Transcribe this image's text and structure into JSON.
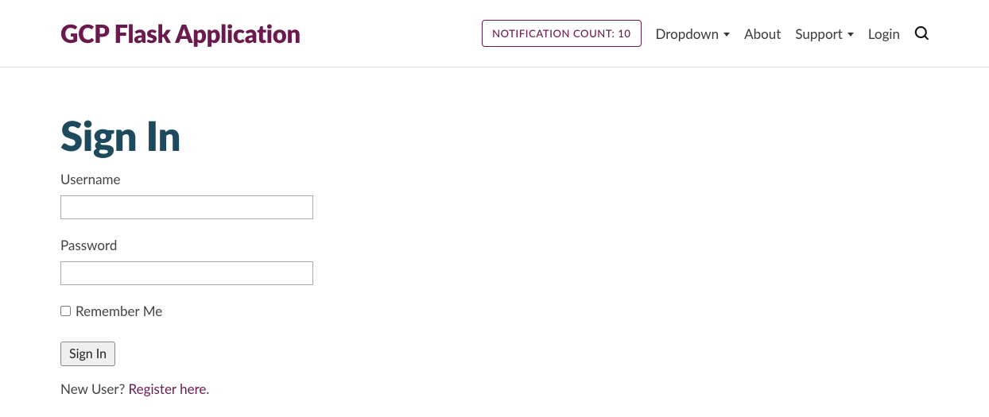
{
  "navbar": {
    "brand": "GCP Flask Application",
    "notification_label": "NOTIFICATION COUNT: 10",
    "dropdown_label": "Dropdown",
    "about_label": "About",
    "support_label": "Support",
    "login_label": "Login"
  },
  "main": {
    "heading": "Sign In",
    "username_label": "Username",
    "password_label": "Password",
    "remember_label": "Remember Me",
    "submit_label": "Sign In",
    "new_user_text": "New User? ",
    "register_link_text": "Register here",
    "period": "."
  }
}
